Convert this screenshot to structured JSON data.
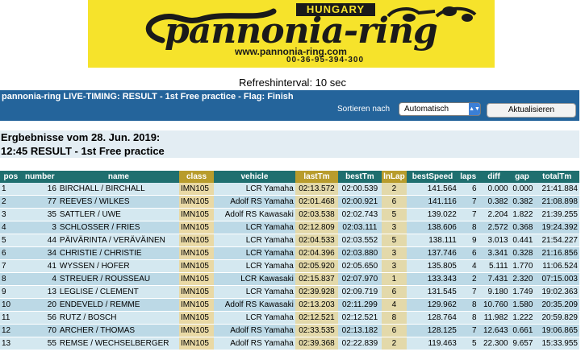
{
  "logo": {
    "country": "HUNGARY",
    "brand": "pannonia-ring",
    "url": "www.pannonia-ring.com",
    "phone": "00-36-95-394-300"
  },
  "refresh_text": "Refreshinterval: 10 sec",
  "header": {
    "title": "pannonia-ring LIVE-TIMING: RESULT - 1st Free practice - Flag: Finish",
    "sort_label": "Sortieren nach",
    "sort_value": "Automatisch",
    "refresh_button": "Aktualisieren"
  },
  "results_title_line1": "Ergbebnisse vom 28. Jun. 2019:",
  "results_title_line2": "12:45  RESULT - 1st Free practice",
  "columns": [
    "pos",
    "number",
    "name",
    "class",
    "vehicle",
    "lastTm",
    "bestTm",
    "lnLap",
    "bestSpeed",
    "laps",
    "diff",
    "gap",
    "totalTm"
  ],
  "rows": [
    [
      "1",
      "16",
      "BIRCHALL / BIRCHALL",
      "IMN105",
      "LCR Yamaha",
      "02:13.572",
      "02:00.539",
      "2",
      "141.564",
      "6",
      "0.000",
      "0.000",
      "21:41.884"
    ],
    [
      "2",
      "77",
      "REEVES / WILKES",
      "IMN105",
      "Adolf RS Yamaha",
      "02:01.468",
      "02:00.921",
      "6",
      "141.116",
      "7",
      "0.382",
      "0.382",
      "21:08.898"
    ],
    [
      "3",
      "35",
      "SATTLER / UWE",
      "IMN105",
      "Adolf RS Kawasaki",
      "02:03.538",
      "02:02.743",
      "5",
      "139.022",
      "7",
      "2.204",
      "1.822",
      "21:39.255"
    ],
    [
      "4",
      "3",
      "SCHLOSSER / FRIES",
      "IMN105",
      "LCR Yamaha",
      "02:12.809",
      "02:03.111",
      "3",
      "138.606",
      "8",
      "2.572",
      "0.368",
      "19:24.392"
    ],
    [
      "5",
      "44",
      "PÄIVÄRINTA / VERÄVÄINEN",
      "IMN105",
      "LCR Yamaha",
      "02:04.533",
      "02:03.552",
      "5",
      "138.111",
      "9",
      "3.013",
      "0.441",
      "21:54.227"
    ],
    [
      "6",
      "34",
      "CHRISTIE / CHRISTIE",
      "IMN105",
      "LCR Yamaha",
      "02:04.396",
      "02:03.880",
      "3",
      "137.746",
      "6",
      "3.341",
      "0.328",
      "21:16.856"
    ],
    [
      "7",
      "41",
      "WYSSEN / HOFER",
      "IMN105",
      "LCR Yamaha",
      "02:05.920",
      "02:05.650",
      "3",
      "135.805",
      "4",
      "5.111",
      "1.770",
      "11:06.524"
    ],
    [
      "8",
      "4",
      "STREUER / ROUSSEAU",
      "IMN105",
      "LCR Kawasaki",
      "02:15.837",
      "02:07.970",
      "1",
      "133.343",
      "2",
      "7.431",
      "2.320",
      "07:15.003"
    ],
    [
      "9",
      "13",
      "LEGLISE / CLEMENT",
      "IMN105",
      "LCR Yamaha",
      "02:39.928",
      "02:09.719",
      "6",
      "131.545",
      "7",
      "9.180",
      "1.749",
      "19:02.363"
    ],
    [
      "10",
      "20",
      "ENDEVELD / REMME",
      "IMN105",
      "Adolf RS Kawasaki",
      "02:13.203",
      "02:11.299",
      "4",
      "129.962",
      "8",
      "10.760",
      "1.580",
      "20:35.209"
    ],
    [
      "11",
      "56",
      "RUTZ / BOSCH",
      "IMN105",
      "LCR Yamaha",
      "02:12.521",
      "02:12.521",
      "8",
      "128.764",
      "8",
      "11.982",
      "1.222",
      "20:59.829"
    ],
    [
      "12",
      "70",
      "ARCHER / THOMAS",
      "IMN105",
      "Adolf RS Yamaha",
      "02:33.535",
      "02:13.182",
      "6",
      "128.125",
      "7",
      "12.643",
      "0.661",
      "19:06.865"
    ],
    [
      "13",
      "55",
      "REMSE / WECHSELBERGER",
      "IMN105",
      "Adolf RS Yamaha",
      "02:39.368",
      "02:22.839",
      "2",
      "119.463",
      "5",
      "22.300",
      "9.657",
      "15:33.955"
    ]
  ]
}
